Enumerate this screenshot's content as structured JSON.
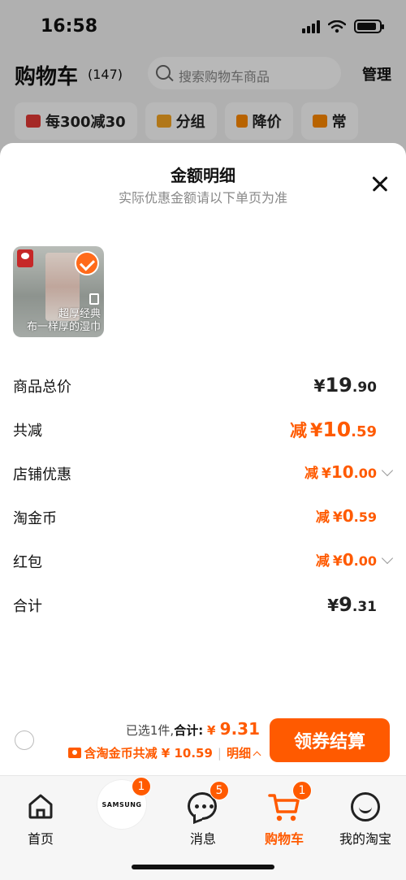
{
  "status_bar": {
    "time": "16:58"
  },
  "cart_header": {
    "title": "购物车",
    "count": "(147)",
    "search_placeholder": "搜索购物车商品",
    "manage": "管理"
  },
  "filters": [
    {
      "label": "每300减30",
      "icon": "coupon-icon"
    },
    {
      "label": "分组",
      "icon": "folder-icon"
    },
    {
      "label": "降价",
      "icon": "down-arrow-icon"
    },
    {
      "label": "常",
      "icon": "cart-icon"
    }
  ],
  "sheet": {
    "title": "金额明细",
    "subtitle": "实际优惠金额请以下单页为准",
    "close_icon": "close-icon"
  },
  "product": {
    "caption_line1": "超厚经典",
    "caption_line2": "布一样厚的湿巾",
    "selected": true
  },
  "price_rows": [
    {
      "label": "商品总价",
      "prefix": "",
      "currency": "¥",
      "int": "19",
      "dec": ".90",
      "style": "black",
      "expandable": false
    },
    {
      "label": "共减",
      "prefix": "减",
      "currency": "¥",
      "int": "10",
      "dec": ".59",
      "style": "orange-big",
      "expandable": false
    },
    {
      "label": "店铺优惠",
      "prefix": "减",
      "currency": "¥",
      "int": "10",
      "dec": ".00",
      "style": "orange",
      "expandable": true
    },
    {
      "label": "淘金币",
      "prefix": "减",
      "currency": "¥",
      "int": "0",
      "dec": ".59",
      "style": "orange",
      "expandable": false
    },
    {
      "label": "红包",
      "prefix": "减",
      "currency": "¥",
      "int": "0",
      "dec": ".00",
      "style": "orange",
      "expandable": true
    },
    {
      "label": "合计",
      "prefix": "",
      "currency": "¥",
      "int": "9",
      "dec": ".31",
      "style": "black",
      "expandable": false
    }
  ],
  "checkout": {
    "selected_prefix": "已选",
    "selected_count": "1",
    "selected_suffix": "件,",
    "total_label": "合计:",
    "total_currency": "¥",
    "total_int": "9",
    "total_dec": ".31",
    "discount_text": "含淘金币共减 ¥ 10.59",
    "detail_label": "明细",
    "button_label": "领券结算"
  },
  "tabs": [
    {
      "label": "首页",
      "icon": "home-icon",
      "badge": ""
    },
    {
      "label": "",
      "icon": "samsung-logo",
      "badge": "1",
      "brand": "SAMSUNG"
    },
    {
      "label": "消息",
      "icon": "message-icon",
      "badge": "5"
    },
    {
      "label": "购物车",
      "icon": "cart-icon",
      "badge": "1",
      "active": true
    },
    {
      "label": "我的淘宝",
      "icon": "profile-icon",
      "badge": ""
    }
  ],
  "colors": {
    "accent": "#ff5a00",
    "text": "#111111",
    "muted": "#888888"
  }
}
